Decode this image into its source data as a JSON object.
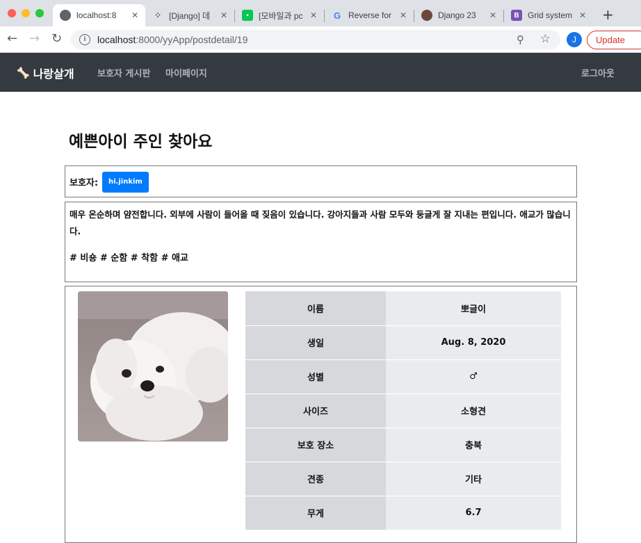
{
  "browser": {
    "tabs": [
      {
        "label": "localhost:8",
        "active": true
      },
      {
        "label": "[Django] 데",
        "active": false
      },
      {
        "label": "[모바일과 pc",
        "active": false
      },
      {
        "label": "Reverse for",
        "active": false
      },
      {
        "label": "Django 23",
        "active": false
      },
      {
        "label": "Grid system",
        "active": false
      }
    ],
    "url_host": "localhost",
    "url_path": ":8000/yyApp/postdetail/19",
    "profile_initial": "J",
    "update_label": "Update"
  },
  "navbar": {
    "brand": "나랑살개",
    "links": [
      "보호자 게시판",
      "마이페이지"
    ],
    "logout": "로그아웃"
  },
  "post": {
    "title": "예쁜아이 주인 찾아요",
    "owner_label": "보호자:",
    "owner_name": "hi.jinkim",
    "description": "매우 온순하며 얌전합니다. 외부에 사람이 들어올 때 짖음이 있습니다. 강아지들과 사람 모두와 둥글게 잘 지내는 편입니다. 애교가 많습니다.",
    "tags": "# 비숑 # 순함 # 착함 # 애교",
    "details": [
      {
        "label": "이름",
        "value": "뽀글이"
      },
      {
        "label": "생일",
        "value": "Aug. 8, 2020"
      },
      {
        "label": "성별",
        "value": "♂"
      },
      {
        "label": "사이즈",
        "value": "소형견"
      },
      {
        "label": "보호 장소",
        "value": "충북"
      },
      {
        "label": "견종",
        "value": "기타"
      },
      {
        "label": "무게",
        "value": "6.7"
      }
    ]
  }
}
